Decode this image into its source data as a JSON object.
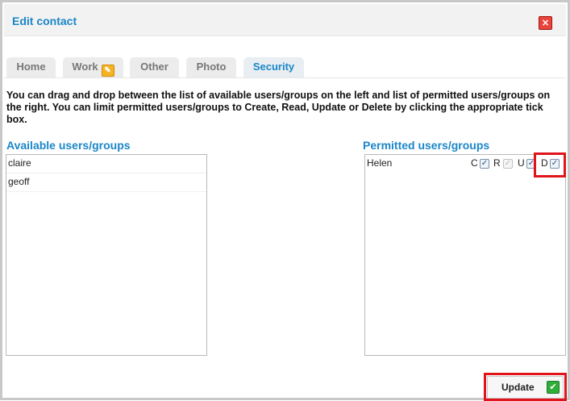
{
  "dialog": {
    "title": "Edit contact",
    "close_glyph": "×"
  },
  "tabs": [
    {
      "label": "Home",
      "active": false
    },
    {
      "label": "Work",
      "active": false,
      "badge_icon": "edit-icon"
    },
    {
      "label": "Other",
      "active": false
    },
    {
      "label": "Photo",
      "active": false
    },
    {
      "label": "Security",
      "active": true
    }
  ],
  "security": {
    "instructions": "You can drag and drop between the list of available users/groups on the left and list of permitted users/groups on the right. You can limit permitted users/groups to Create, Read, Update or Delete by clicking the appropriate tick box.",
    "available_heading": "Available users/groups",
    "available_items": [
      "claire",
      "geoff"
    ],
    "permitted_heading": "Permitted users/groups",
    "permitted": [
      {
        "name": "Helen",
        "c_label": "C",
        "c_checked": true,
        "r_label": "R",
        "r_checked": true,
        "r_disabled": true,
        "u_label": "U",
        "u_checked": true,
        "d_label": "D",
        "d_checked": true
      }
    ]
  },
  "footer": {
    "update_label": "Update",
    "update_icon": "checkmark-icon"
  },
  "colors": {
    "accent": "#1a86c8",
    "highlight": "#e0141b",
    "close": "#e8443a",
    "ok": "#2fae3a"
  }
}
